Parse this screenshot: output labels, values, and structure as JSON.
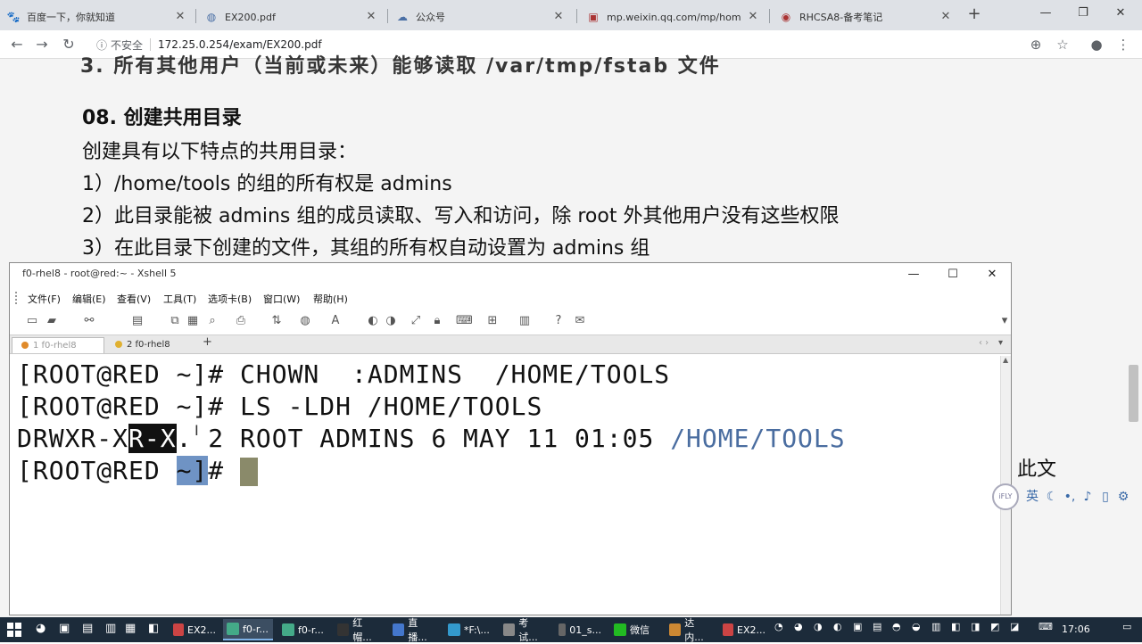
{
  "browser": {
    "tabs": [
      {
        "title": "百度一下，你就知道",
        "icon": "paw-icon"
      },
      {
        "title": "EX200.pdf",
        "icon": "globe-icon"
      },
      {
        "title": "公众号",
        "icon": "cloud-icon"
      },
      {
        "title": "mp.weixin.qq.com/mp/hom",
        "icon": "page-icon"
      },
      {
        "title": "RHCSA8-备考笔记",
        "icon": "note-icon"
      }
    ],
    "new_tab": "+",
    "insecure_label": "不安全",
    "url": "172.25.0.254/exam/EX200.pdf"
  },
  "pdf": {
    "cut_line": "3. 所有其他用户（当前或未来）能够读取 /var/tmp/fstab 文件",
    "heading": "08. 创建共用目录",
    "intro": "创建具有以下特点的共用目录：",
    "items": [
      "1）/home/tools 的组的所有权是 admins",
      "2）此目录能被 admins 组的成员读取、写入和访问，除 root 外其他用户没有这些权限",
      "3）在此目录下创建的文件，其组的所有权自动设置为 admins 组"
    ]
  },
  "xshell": {
    "title": "f0-rhel8 - root@red:~ - Xshell 5",
    "menu": [
      "文件(F)",
      "编辑(E)",
      "查看(V)",
      "工具(T)",
      "选项卡(B)",
      "窗口(W)",
      "帮助(H)"
    ],
    "tabs": [
      "1 f0-rhel8",
      "2 f0-rhel8"
    ],
    "add_tab": "+",
    "terminal": {
      "line1": "[ROOT@RED ~]# CHOWN  :ADMINS  /HOME/TOOLS",
      "line2": "[ROOT@RED ~]# LS -LDH /HOME/TOOLS",
      "line3_perm_a": "DRWXR-X",
      "line3_perm_hl": "R-X",
      "line3_rest": ". 2 ROOT ADMINS 6 MAY 11 01:05 ",
      "line3_dir": "/HOME/TOOLS",
      "line4_prompt_a": "[ROOT@RED ",
      "line4_sel": "~]",
      "line4_prompt_b": "# "
    }
  },
  "ime": {
    "word": "此文",
    "logo": "iFLY",
    "mode": "英"
  },
  "taskbar": {
    "items": [
      "EX2...",
      "f0-r...",
      "f0-r...",
      "红帽...",
      "直播...",
      "*F:\\...",
      "考试...",
      "01_s...",
      "微信",
      "达内...",
      "EX2..."
    ],
    "clock": "17:06"
  }
}
